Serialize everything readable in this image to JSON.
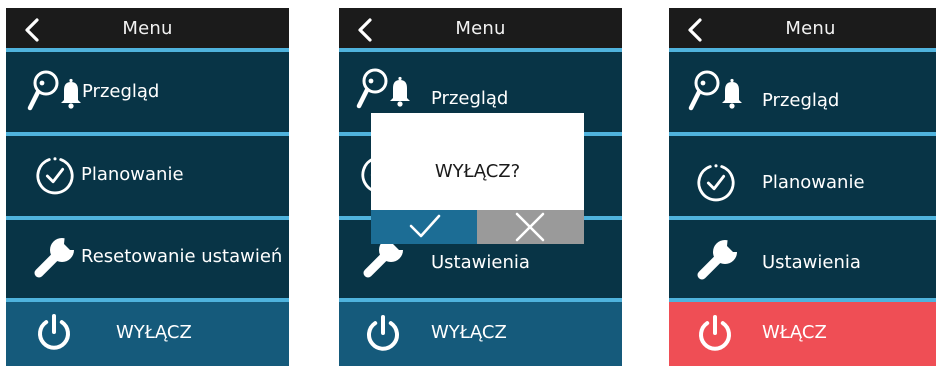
{
  "colors": {
    "header_bg": "#1b1b1b",
    "row_bg": "#083446",
    "separator": "#4fb3dd",
    "power_row_bg": "#155a7b",
    "power_on_bg": "#ef4e55",
    "confirm_bg": "#1c6d95",
    "cancel_bg": "#9a9a9a"
  },
  "screens": [
    {
      "header": {
        "title": "Menu",
        "back_icon": "chevron-left-icon"
      },
      "items": [
        {
          "icon": "search-bell-icon",
          "label": "Przegląd"
        },
        {
          "icon": "clock-icon",
          "label": "Planowanie"
        },
        {
          "icon": "wrench-icon",
          "label": "Resetowanie ustawień"
        }
      ],
      "power": {
        "icon": "power-icon",
        "label": "WYŁĄCZ"
      }
    },
    {
      "header": {
        "title": "Menu",
        "back_icon": "chevron-left-icon"
      },
      "items": [
        {
          "icon": "search-bell-icon",
          "label": "Przegląd"
        },
        {
          "icon": "clock-icon",
          "label": ""
        },
        {
          "icon": "wrench-icon",
          "label": "Ustawienia"
        }
      ],
      "power": {
        "icon": "power-icon",
        "label": "WYŁĄCZ"
      },
      "dialog": {
        "message": "WYŁĄCZ?",
        "confirm_icon": "check-icon",
        "cancel_icon": "close-icon"
      }
    },
    {
      "header": {
        "title": "Menu",
        "back_icon": "chevron-left-icon"
      },
      "items": [
        {
          "icon": "search-bell-icon",
          "label": "Przegląd"
        },
        {
          "icon": "clock-icon",
          "label": "Planowanie"
        },
        {
          "icon": "wrench-icon",
          "label": "Ustawienia"
        }
      ],
      "power": {
        "icon": "power-icon",
        "label": "WŁĄCZ"
      }
    }
  ]
}
